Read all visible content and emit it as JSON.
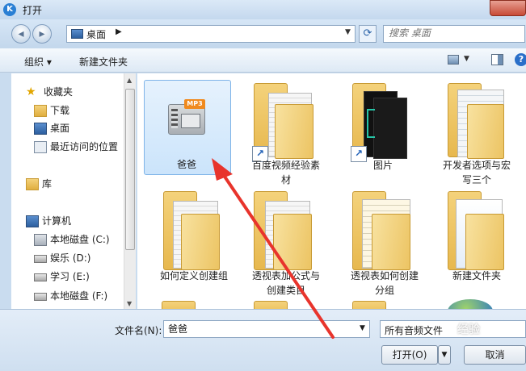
{
  "window": {
    "title": "打开"
  },
  "address": {
    "location": "桌面",
    "search_placeholder": "搜索 桌面"
  },
  "toolbar": {
    "organize": "组织 ▾",
    "new_folder": "新建文件夹"
  },
  "sidebar": {
    "items": [
      {
        "label": "收藏夹",
        "icon": "star-icon"
      },
      {
        "label": "下载",
        "icon": "download-folder-icon"
      },
      {
        "label": "桌面",
        "icon": "desktop-icon"
      },
      {
        "label": "最近访问的位置",
        "icon": "recent-places-icon"
      },
      {
        "label": "库",
        "icon": "library-icon"
      },
      {
        "label": "计算机",
        "icon": "computer-icon"
      },
      {
        "label": "本地磁盘 (C:)",
        "icon": "system-drive-icon"
      },
      {
        "label": "娱乐 (D:)",
        "icon": "drive-icon"
      },
      {
        "label": "学习 (E:)",
        "icon": "drive-icon"
      },
      {
        "label": "本地磁盘 (F:)",
        "icon": "drive-icon"
      }
    ]
  },
  "files": [
    {
      "label": "爸爸",
      "type": "mp3-file",
      "badge": "MP3"
    },
    {
      "label": "百度视频经验素\n材",
      "type": "folder-shortcut"
    },
    {
      "label": "图片",
      "type": "folder-shortcut"
    },
    {
      "label": "开发者选项与宏\n写三个",
      "type": "folder"
    },
    {
      "label": "如何定义创建组",
      "type": "folder"
    },
    {
      "label": "透视表加公式与\n创建类目",
      "type": "folder"
    },
    {
      "label": "透视表如何创建\n分组",
      "type": "folder"
    },
    {
      "label": "新建文件夹",
      "type": "folder"
    }
  ],
  "footer": {
    "filename_label": "文件名(N):",
    "filename_value": "爸爸",
    "filetype": "所有音频文件",
    "open_label": "打开(O)",
    "cancel_label": "取消"
  },
  "watermark": "经验",
  "colors": {
    "accent": "#2a7fd4",
    "arrow": "#e8342c",
    "selection": "#cbe4fb"
  }
}
